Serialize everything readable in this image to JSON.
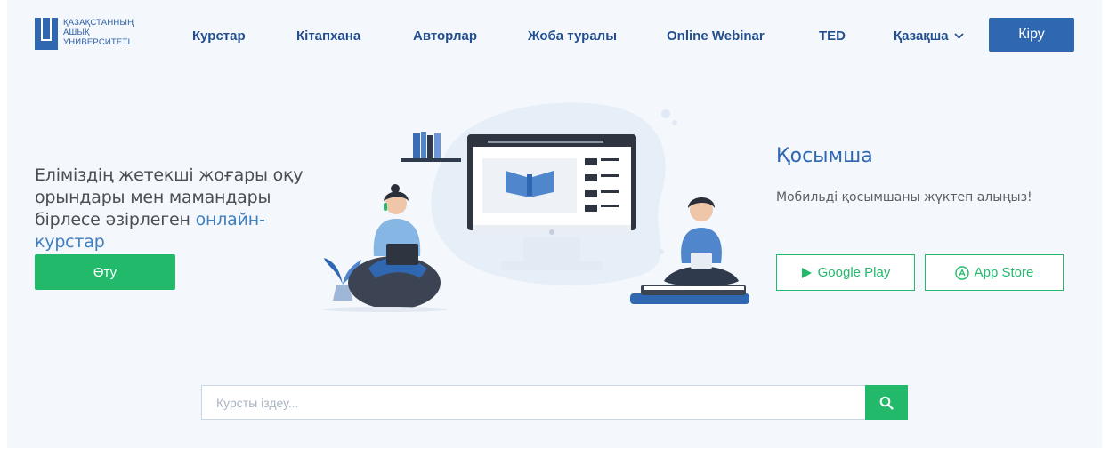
{
  "header": {
    "logo_lines": [
      "ҚАЗАҚСТАННЫҢ",
      "АШЫҚ",
      "УНИВЕРСИТЕТІ"
    ],
    "nav": [
      {
        "label": "Курстар"
      },
      {
        "label": "Кітапхана"
      },
      {
        "label": "Авторлар"
      },
      {
        "label": "Жоба туралы"
      },
      {
        "label": "Online Webinar"
      },
      {
        "label": "TED"
      }
    ],
    "language": "Қазақша",
    "login_label": "Кіру"
  },
  "hero": {
    "text_main": "Еліміздің жетекші жоғары оқу орындары мен мамандары бірлесе әзірлеген ",
    "text_highlight": "онлайн-курстар",
    "cta_label": "Өту"
  },
  "app": {
    "title": "Қосымша",
    "subtitle": "Мобильді қосымшаны жүктеп алыңыз!",
    "google_play_label": "Google Play",
    "app_store_label": "App Store"
  },
  "search": {
    "placeholder": "Курсты іздеу..."
  },
  "colors": {
    "brand_blue": "#2f67b1",
    "accent_green": "#23b96b",
    "background": "#f4f7fb"
  }
}
